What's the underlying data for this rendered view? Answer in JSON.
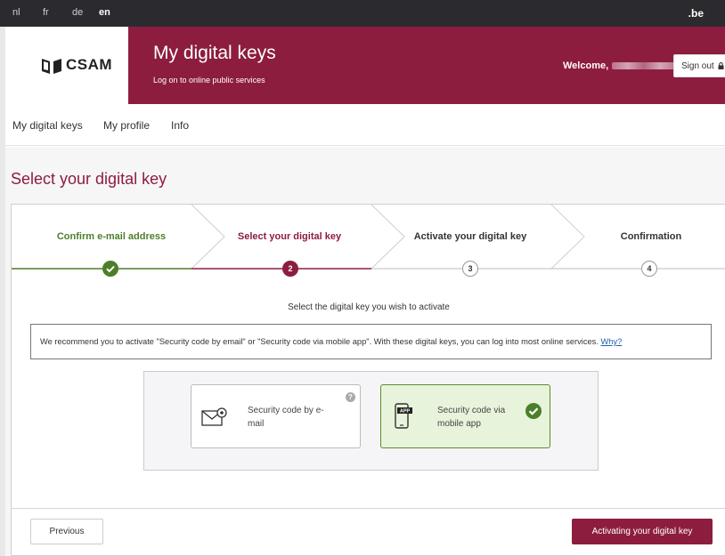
{
  "languages": [
    {
      "code": "nl",
      "active": false
    },
    {
      "code": "fr",
      "active": false
    },
    {
      "code": "de",
      "active": false
    },
    {
      "code": "en",
      "active": true
    }
  ],
  "topbar_domain": ".be",
  "header": {
    "logo": "CSAM",
    "title": "My digital keys",
    "subtitle": "Log on to online public services",
    "welcome": "Welcome,",
    "sign_out": "Sign out"
  },
  "nav": {
    "items": [
      "My digital keys",
      "My profile",
      "Info"
    ]
  },
  "page_title": "Select your digital key",
  "steps": [
    {
      "label": "Confirm e-mail address",
      "number": "1",
      "state": "done"
    },
    {
      "label": "Select your digital key",
      "number": "2",
      "state": "current"
    },
    {
      "label": "Activate your digital key",
      "number": "3",
      "state": "upcoming"
    },
    {
      "label": "Confirmation",
      "number": "4",
      "state": "upcoming"
    }
  ],
  "instruction": "Select the digital key you wish to activate",
  "recommendation": {
    "text": "We recommend you to activate \"Security code by email\" or \"Security code via mobile app\". With these digital keys, you can log into most online services. ",
    "link": "Why?"
  },
  "options": [
    {
      "label": "Security code by e-mail",
      "icon": "envelope-icon",
      "selected": false,
      "help": "?"
    },
    {
      "label": "Security code via mobile app",
      "icon": "phone-app-icon",
      "icon_badge": "APP",
      "selected": true
    }
  ],
  "buttons": {
    "previous": "Previous",
    "next": "Activating your digital key"
  },
  "colors": {
    "brand": "#8d1d3e",
    "done": "#4c7f2a",
    "topbar": "#2b2b2f"
  }
}
